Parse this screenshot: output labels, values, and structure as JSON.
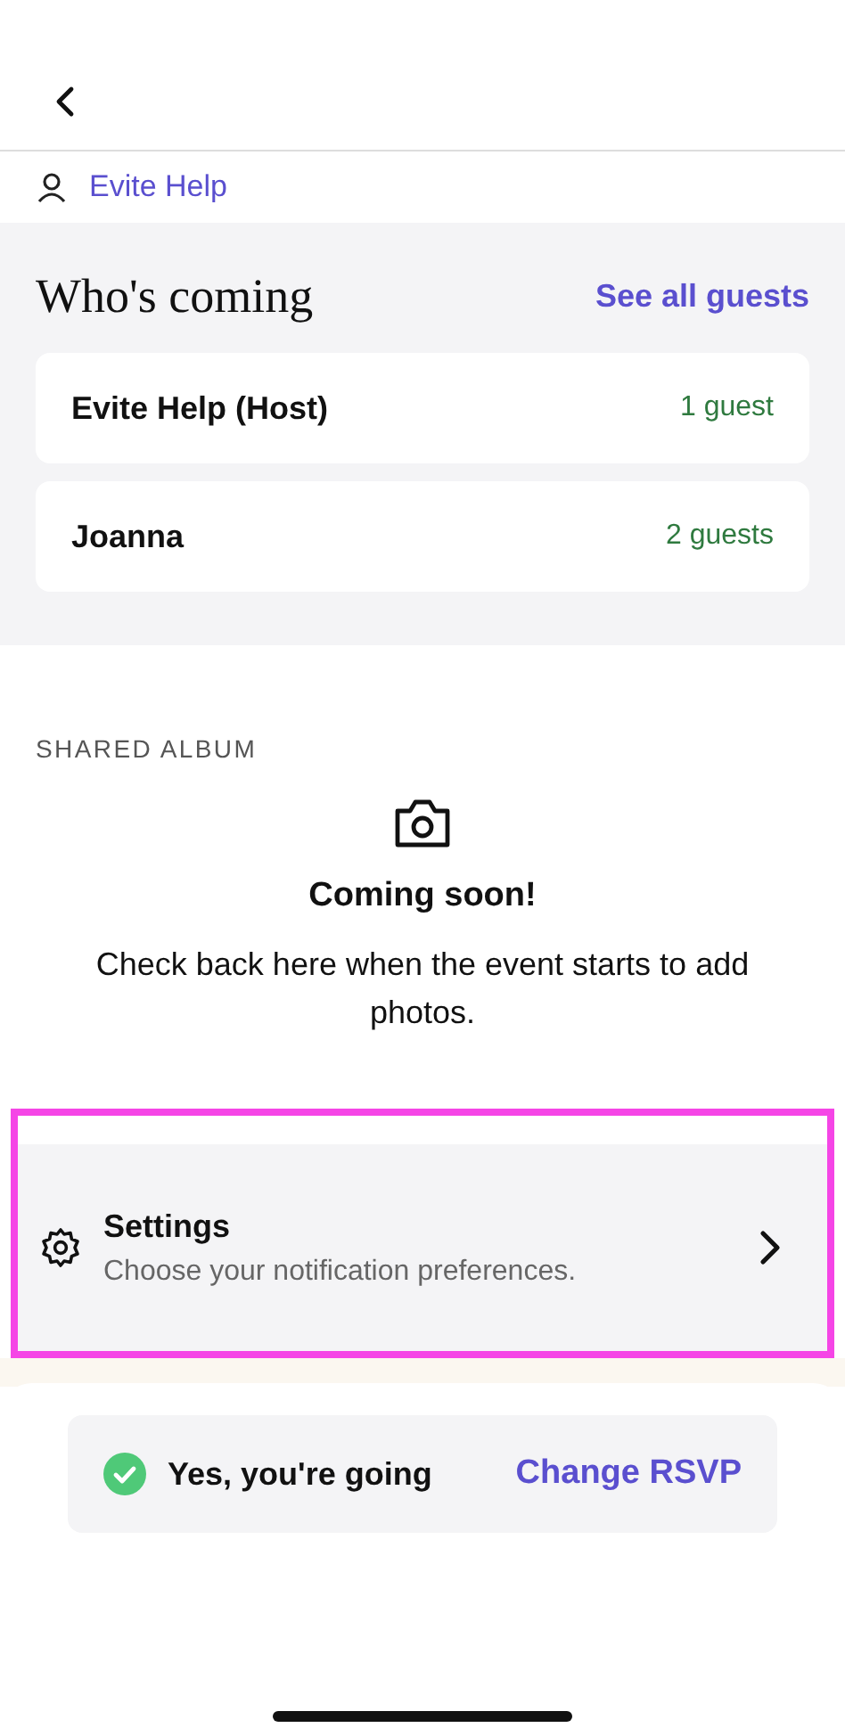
{
  "host_link": {
    "label": "Evite Help"
  },
  "guests": {
    "title": "Who's coming",
    "see_all": "See all guests",
    "rows": [
      {
        "name": "Evite Help (Host)",
        "count": "1 guest"
      },
      {
        "name": "Joanna",
        "count": "2 guests"
      }
    ]
  },
  "album": {
    "heading": "SHARED ALBUM",
    "title": "Coming soon!",
    "text": "Check back here when the event starts to add photos."
  },
  "settings": {
    "title": "Settings",
    "subtitle": "Choose your notification preferences.",
    "highlighted": true
  },
  "rsvp": {
    "status": "Yes, you're going",
    "going": true,
    "action": "Change RSVP"
  }
}
